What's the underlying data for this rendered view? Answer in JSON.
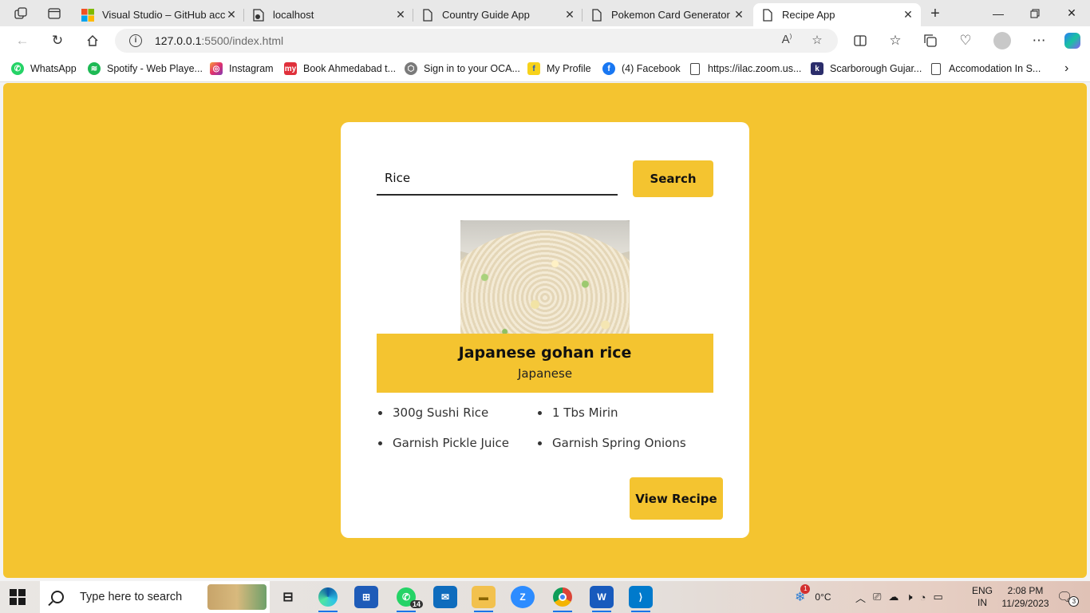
{
  "browser": {
    "tabs": [
      {
        "title": "Visual Studio – GitHub acco",
        "favicon": "microsoft-icon"
      },
      {
        "title": "localhost",
        "favicon": "local-file-icon"
      },
      {
        "title": "Country Guide App",
        "favicon": "page-icon"
      },
      {
        "title": "Pokemon Card Generator",
        "favicon": "page-icon"
      },
      {
        "title": "Recipe App",
        "favicon": "page-icon",
        "active": true
      }
    ],
    "url_host": "127.0.0.1",
    "url_path": ":5500/index.html",
    "bookmarks": [
      {
        "label": "WhatsApp",
        "icon": "whatsapp-icon"
      },
      {
        "label": "Spotify - Web Playe...",
        "icon": "spotify-icon"
      },
      {
        "label": "Instagram",
        "icon": "instagram-icon"
      },
      {
        "label": "Book Ahmedabad t...",
        "icon": "makemytrip-icon"
      },
      {
        "label": "Sign in to your OCA...",
        "icon": "oca-icon"
      },
      {
        "label": "My Profile",
        "icon": "flipkart-icon"
      },
      {
        "label": "(4) Facebook",
        "icon": "facebook-icon"
      },
      {
        "label": "https://ilac.zoom.us...",
        "icon": "page-icon"
      },
      {
        "label": "Scarborough Gujar...",
        "icon": "k-icon"
      },
      {
        "label": "Accomodation In S...",
        "icon": "page-icon"
      }
    ]
  },
  "app": {
    "search": {
      "value": "Rice",
      "button_label": "Search"
    },
    "recipe": {
      "title": "Japanese gohan rice",
      "area": "Japanese",
      "image": "fried-rice-photo",
      "ingredients": [
        "300g Sushi Rice",
        "1 Tbs Mirin",
        "Garnish Pickle Juice",
        "Garnish Spring Onions"
      ],
      "view_button_label": "View Recipe"
    }
  },
  "taskbar": {
    "search_placeholder": "Type here to search",
    "whatsapp_badge": "14",
    "weather": "0°C",
    "weather_badge": "1",
    "lang_line1": "ENG",
    "lang_line2": "IN",
    "time": "2:08 PM",
    "date": "11/29/2023",
    "notifications": "3"
  },
  "colors": {
    "page_background": "#f4c430",
    "card": "#ffffff",
    "accent": "#f4c430",
    "taskbar_running_indicator": "#1a73e8"
  }
}
